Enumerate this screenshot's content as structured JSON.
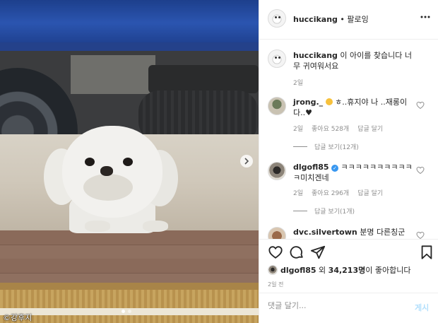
{
  "photo": {
    "watermark": "©강후지",
    "carousel": {
      "total": 2,
      "active": 0
    },
    "next_icon": "chevron-right-icon"
  },
  "header": {
    "username": "huccikang",
    "separator": " • ",
    "follow_status": "팔로잉",
    "more_icon": "ellipsis-icon"
  },
  "caption": {
    "username": "huccikang",
    "text": "이 아이를 찾습니다 너무 귀여워서요",
    "time": "2일"
  },
  "comments": [
    {
      "username": "jrong._",
      "text": "ㅎ..휴지야 나 ..재롱이다..♥",
      "time": "2일",
      "likes": "좋아요 528개",
      "reply": "답글 달기",
      "view_replies": "답글 보기(12개)"
    },
    {
      "username": "dlgofl85",
      "text": "ㅋㅋㅋㅋㅋㅋㅋㅋㅋㅋㅋ미치겐네",
      "time": "2일",
      "likes": "좋아요 296개",
      "reply": "답글 달기",
      "view_replies": "답글 보기(1개)"
    },
    {
      "username": "dvc.silvertown",
      "text": "분명 다른칭군데.."
    }
  ],
  "actions": {
    "like_icon": "heart-icon",
    "comment_icon": "comment-icon",
    "share_icon": "send-icon",
    "save_icon": "bookmark-icon"
  },
  "likes": {
    "username": "dlgofl85",
    "middle": " 외 ",
    "count": "34,213명",
    "suffix": "이 좋아합니다"
  },
  "time_ago": "2일 전",
  "comment_box": {
    "placeholder": "댓글 달기...",
    "post_label": "게시"
  },
  "colors": {
    "link_blue": "#3897f0",
    "muted_text": "#8e8e8e",
    "post_disabled": "#b2dffc"
  }
}
